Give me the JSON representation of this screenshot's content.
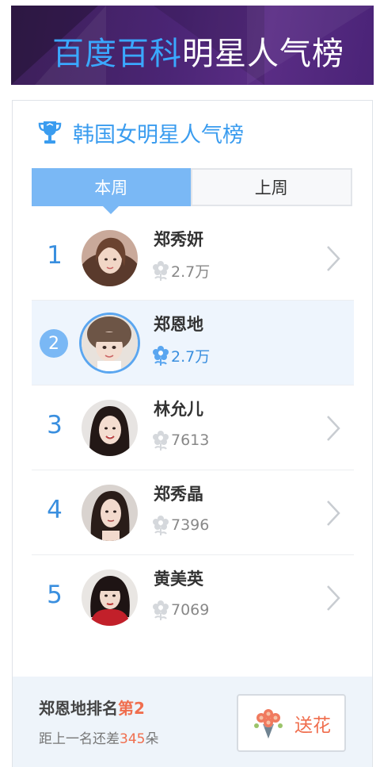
{
  "banner": {
    "title_part1": "百度百科",
    "title_part2": "明星人气榜"
  },
  "card": {
    "title": "韩国女明星人气榜",
    "icon": "trophy-icon"
  },
  "tabs": [
    {
      "label": "本周",
      "active": true
    },
    {
      "label": "上周",
      "active": false
    }
  ],
  "list": [
    {
      "rank": "1",
      "name": "郑秀妍",
      "score": "2.7万",
      "highlighted": false
    },
    {
      "rank": "2",
      "name": "郑恩地",
      "score": "2.7万",
      "highlighted": true
    },
    {
      "rank": "3",
      "name": "林允儿",
      "score": "7613",
      "highlighted": false
    },
    {
      "rank": "4",
      "name": "郑秀晶",
      "score": "7396",
      "highlighted": false
    },
    {
      "rank": "5",
      "name": "黄美英",
      "score": "7069",
      "highlighted": false
    }
  ],
  "footer": {
    "name": "郑恩地",
    "rank_text": "排名",
    "rank_value": "第2",
    "gap_prefix": "距上一名还差",
    "gap_value": "345",
    "gap_suffix": "朵",
    "send_label": "送花"
  },
  "colors": {
    "accent_blue": "#3a9cef",
    "tab_active": "#7ab8f5",
    "accent_orange": "#f06e4e",
    "banner_purple": "#4b2575"
  }
}
